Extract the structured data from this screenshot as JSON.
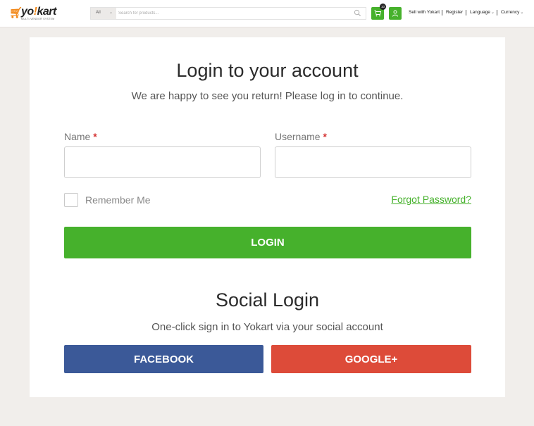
{
  "header": {
    "logo": {
      "text_pre": "yo",
      "text_excl": "!",
      "text_post": "kart",
      "tagline": "MULTI-VENDOR SYSTEM",
      "icon": "cart-logo-icon"
    },
    "search": {
      "category": "All",
      "placeholder": "Search for products..."
    },
    "cart_count": "10",
    "nav": {
      "sell": "Sell with Yokart",
      "register": "Register",
      "language": "Language",
      "currency": "Currency"
    }
  },
  "login": {
    "title": "Login to your account",
    "subtitle": "We are happy to see you return! Please log in to continue.",
    "name_label": "Name",
    "username_label": "Username",
    "required_mark": "*",
    "name_value": "",
    "username_value": "",
    "remember_label": "Remember Me",
    "forgot_label": "Forgot Password?",
    "login_button": "LOGIN"
  },
  "social": {
    "title": "Social Login",
    "subtitle": "One-click sign in to Yokart via your social account",
    "facebook_button": "FACEBOOK",
    "google_button": "GOOGLE+"
  },
  "colors": {
    "accent_green": "#46b12c",
    "facebook_blue": "#3b5998",
    "google_red": "#dd4b39",
    "logo_orange": "#f28a1c",
    "background": "#f1eeeb"
  }
}
